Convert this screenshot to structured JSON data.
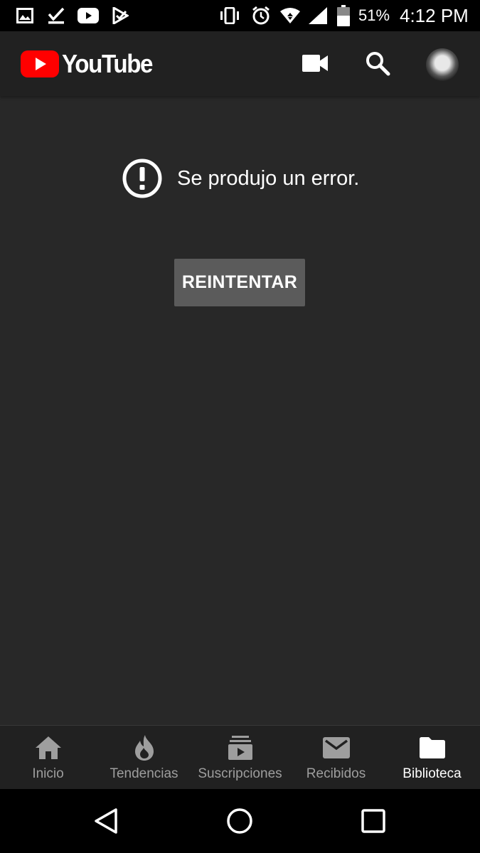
{
  "status_bar": {
    "battery": "51%",
    "time": "4:12 PM",
    "icons": [
      "image-icon",
      "download-done-icon",
      "youtube-icon",
      "play-store-icon",
      "vibrate-icon",
      "alarm-icon",
      "wifi-icon",
      "signal-icon",
      "battery-icon"
    ]
  },
  "app_bar": {
    "logo_text": "YouTube",
    "icons": [
      "video-camera-icon",
      "search-icon",
      "account-avatar"
    ]
  },
  "error": {
    "message": "Se produjo un error.",
    "retry_label": "REINTENTAR"
  },
  "bottom_nav": {
    "items": [
      {
        "label": "Inicio",
        "icon": "home-icon"
      },
      {
        "label": "Tendencias",
        "icon": "flame-icon"
      },
      {
        "label": "Suscripciones",
        "icon": "subscriptions-icon"
      },
      {
        "label": "Recibidos",
        "icon": "mail-icon"
      },
      {
        "label": "Biblioteca",
        "icon": "folder-icon"
      }
    ],
    "active": "Biblioteca"
  },
  "colors": {
    "background": "#282828",
    "appbar": "#212121",
    "brand_red": "#ff0000",
    "button": "#5b5b5b",
    "inactive_label": "#9e9e9e"
  }
}
